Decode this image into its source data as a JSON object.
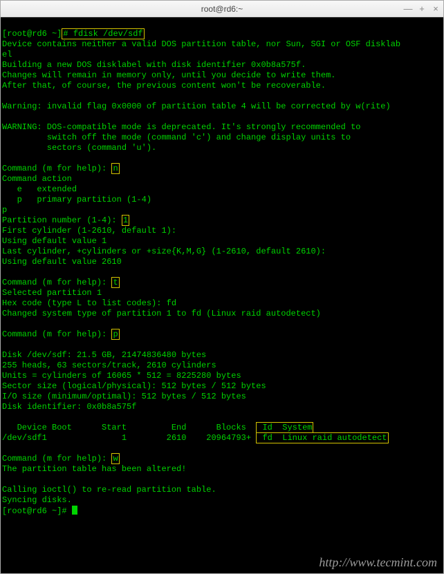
{
  "window": {
    "title": "root@rd6:~"
  },
  "prompt": {
    "user_host": "root@rd6",
    "path": "~",
    "cmd": "fdisk /dev/sdf"
  },
  "lines": {
    "l1": "Device contains neither a valid DOS partition table, nor Sun, SGI or OSF disklab",
    "l2": "el",
    "l3": "Building a new DOS disklabel with disk identifier 0x0b8a575f.",
    "l4": "Changes will remain in memory only, until you decide to write them.",
    "l5": "After that, of course, the previous content won't be recoverable.",
    "l6": "",
    "l7": "Warning: invalid flag 0x0000 of partition table 4 will be corrected by w(rite)",
    "l8": "",
    "l9": "WARNING: DOS-compatible mode is deprecated. It's strongly recommended to",
    "l10": "         switch off the mode (command 'c') and change display units to",
    "l11": "         sectors (command 'u').",
    "l12": "",
    "cmd_help1": "Command (m for help): ",
    "input_n": "n",
    "l14": "Command action",
    "l15": "   e   extended",
    "l16": "   p   primary partition (1-4)",
    "l17": "p",
    "pnum_label": "Partition number (1-4): ",
    "input_1": "1",
    "l19": "First cylinder (1-2610, default 1):",
    "l20": "Using default value 1",
    "l21": "Last cylinder, +cylinders or +size{K,M,G} (1-2610, default 2610):",
    "l22": "Using default value 2610",
    "l23": "",
    "cmd_help2": "Command (m for help): ",
    "input_t": "t",
    "l25": "Selected partition 1",
    "l26": "Hex code (type L to list codes): fd",
    "l27": "Changed system type of partition 1 to fd (Linux raid autodetect)",
    "l28": "",
    "cmd_help3": "Command (m for help): ",
    "input_p": "p",
    "l30": "",
    "l31": "Disk /dev/sdf: 21.5 GB, 21474836480 bytes",
    "l32": "255 heads, 63 sectors/track, 2610 cylinders",
    "l33": "Units = cylinders of 16065 * 512 = 8225280 bytes",
    "l34": "Sector size (logical/physical): 512 bytes / 512 bytes",
    "l35": "I/O size (minimum/optimal): 512 bytes / 512 bytes",
    "l36": "Disk identifier: 0x0b8a575f",
    "l37": "",
    "tbl_head_left": "   Device Boot      Start         End      Blocks  ",
    "tbl_head_right": " Id  System",
    "tbl_row_left": "/dev/sdf1               1        2610    20964793+ ",
    "tbl_row_right": " fd  Linux raid autodetect",
    "l40": "",
    "cmd_help4": "Command (m for help): ",
    "input_w": "w",
    "l42": "The partition table has been altered!",
    "l43": "",
    "l44": "Calling ioctl() to re-read partition table.",
    "l45": "Syncing disks.",
    "prompt2_user_host": "root@rd6",
    "prompt2_path": "~"
  },
  "watermark": "http://www.tecmint.com"
}
